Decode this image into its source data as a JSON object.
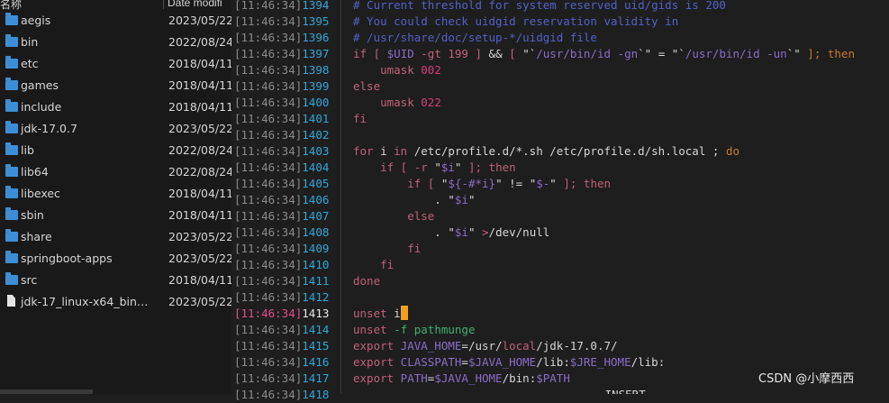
{
  "file_panel": {
    "column_name_label": "名称",
    "column_date_label": "Date modifi",
    "items": [
      {
        "name": "aegis",
        "date": "2023/05/22",
        "icon": "folder-icon"
      },
      {
        "name": "bin",
        "date": "2022/08/24",
        "icon": "folder-icon"
      },
      {
        "name": "etc",
        "date": "2018/04/11",
        "icon": "folder-icon"
      },
      {
        "name": "games",
        "date": "2018/04/11",
        "icon": "folder-icon"
      },
      {
        "name": "include",
        "date": "2018/04/11",
        "icon": "folder-icon"
      },
      {
        "name": "jdk-17.0.7",
        "date": "2023/05/22",
        "icon": "folder-icon"
      },
      {
        "name": "lib",
        "date": "2022/08/24",
        "icon": "folder-icon"
      },
      {
        "name": "lib64",
        "date": "2022/08/24",
        "icon": "folder-icon"
      },
      {
        "name": "libexec",
        "date": "2018/04/11",
        "icon": "folder-icon"
      },
      {
        "name": "sbin",
        "date": "2018/04/11",
        "icon": "folder-icon"
      },
      {
        "name": "share",
        "date": "2023/05/22",
        "icon": "folder-icon"
      },
      {
        "name": "springboot-apps",
        "date": "2023/05/22",
        "icon": "folder-icon"
      },
      {
        "name": "src",
        "date": "2018/04/11",
        "icon": "folder-icon"
      },
      {
        "name": "jdk-17_linux-x64_bin…",
        "date": "2023/05/22",
        "icon": "file-icon"
      }
    ]
  },
  "terminal": {
    "timestamp": "[11:46:34]",
    "current_line": 1413,
    "lines": [
      {
        "no": "1394",
        "segments": [
          {
            "t": "# Current threshold for system reserved uid/gids is 200",
            "c": "cm"
          }
        ]
      },
      {
        "no": "1395",
        "segments": [
          {
            "t": "# You could check uidgid reservation validity in",
            "c": "cm"
          }
        ]
      },
      {
        "no": "1396",
        "segments": [
          {
            "t": "# /usr/share/doc/setup-*/uidgid file",
            "c": "cm"
          }
        ]
      },
      {
        "no": "1397",
        "segments": [
          {
            "t": "if [ ",
            "c": "kw"
          },
          {
            "t": "$UID",
            "c": "var"
          },
          {
            "t": " -gt 199 ] ",
            "c": "kw"
          },
          {
            "t": "&& ",
            "c": "str"
          },
          {
            "t": "[ ",
            "c": "kw"
          },
          {
            "t": "\"`",
            "c": "str"
          },
          {
            "t": "/usr/bin/id -gn",
            "c": "var"
          },
          {
            "t": "`\" = \"`",
            "c": "str"
          },
          {
            "t": "/usr/bin/id -un",
            "c": "var"
          },
          {
            "t": "`\" ",
            "c": "str"
          },
          {
            "t": "]; then",
            "c": "kw2"
          }
        ]
      },
      {
        "no": "1398",
        "segments": [
          {
            "t": "    umask ",
            "c": "kw"
          },
          {
            "t": "002",
            "c": "num"
          }
        ]
      },
      {
        "no": "1399",
        "segments": [
          {
            "t": "else",
            "c": "kw"
          }
        ]
      },
      {
        "no": "1400",
        "segments": [
          {
            "t": "    umask ",
            "c": "kw"
          },
          {
            "t": "022",
            "c": "num"
          }
        ]
      },
      {
        "no": "1401",
        "segments": [
          {
            "t": "fi",
            "c": "kw"
          }
        ]
      },
      {
        "no": "1402",
        "segments": []
      },
      {
        "no": "1403",
        "segments": [
          {
            "t": "for",
            "c": "kw"
          },
          {
            "t": " i ",
            "c": "str"
          },
          {
            "t": "in",
            "c": "kw"
          },
          {
            "t": " /etc/profile.d/*.sh /etc/profile.d/sh.local ; ",
            "c": "str"
          },
          {
            "t": "do",
            "c": "kw2"
          }
        ]
      },
      {
        "no": "1404",
        "segments": [
          {
            "t": "    if [ -r ",
            "c": "kw"
          },
          {
            "t": "\"",
            "c": "str"
          },
          {
            "t": "$i",
            "c": "var"
          },
          {
            "t": "\" ",
            "c": "str"
          },
          {
            "t": "]; then",
            "c": "kw"
          }
        ]
      },
      {
        "no": "1405",
        "segments": [
          {
            "t": "        if [ ",
            "c": "kw"
          },
          {
            "t": "\"",
            "c": "str"
          },
          {
            "t": "${-#*i}",
            "c": "var"
          },
          {
            "t": "\" != \"",
            "c": "str"
          },
          {
            "t": "$-",
            "c": "var"
          },
          {
            "t": "\" ",
            "c": "str"
          },
          {
            "t": "]; then",
            "c": "kw"
          }
        ]
      },
      {
        "no": "1406",
        "segments": [
          {
            "t": "            . ",
            "c": "str"
          },
          {
            "t": "\"",
            "c": "str"
          },
          {
            "t": "$i",
            "c": "var"
          },
          {
            "t": "\"",
            "c": "str"
          }
        ]
      },
      {
        "no": "1407",
        "segments": [
          {
            "t": "        else",
            "c": "kw"
          }
        ]
      },
      {
        "no": "1408",
        "segments": [
          {
            "t": "            . ",
            "c": "str"
          },
          {
            "t": "\"",
            "c": "str"
          },
          {
            "t": "$i",
            "c": "var"
          },
          {
            "t": "\" ",
            "c": "str"
          },
          {
            "t": ">",
            "c": "kw"
          },
          {
            "t": "/dev/null",
            "c": "str"
          }
        ]
      },
      {
        "no": "1409",
        "segments": [
          {
            "t": "        fi",
            "c": "kw"
          }
        ]
      },
      {
        "no": "1410",
        "segments": [
          {
            "t": "    fi",
            "c": "kw"
          }
        ]
      },
      {
        "no": "1411",
        "segments": [
          {
            "t": "done",
            "c": "kw"
          }
        ]
      },
      {
        "no": "1412",
        "segments": []
      },
      {
        "no": "1413",
        "segments": [
          {
            "t": "unset",
            "c": "kw"
          },
          {
            "t": " i",
            "c": "str"
          }
        ]
      },
      {
        "no": "1414",
        "segments": [
          {
            "t": "unset",
            "c": "kw"
          },
          {
            "t": " -f pathmunge",
            "c": "grn"
          }
        ]
      },
      {
        "no": "1415",
        "segments": [
          {
            "t": "export",
            "c": "kw"
          },
          {
            "t": " JAVA_HOME",
            "c": "var"
          },
          {
            "t": "=/usr/",
            "c": "str"
          },
          {
            "t": "local",
            "c": "kw"
          },
          {
            "t": "/jdk-17.0.7/",
            "c": "str"
          }
        ]
      },
      {
        "no": "1416",
        "segments": [
          {
            "t": "export",
            "c": "kw"
          },
          {
            "t": " CLASSPATH",
            "c": "var"
          },
          {
            "t": "=",
            "c": "str"
          },
          {
            "t": "$JAVA_HOME",
            "c": "var"
          },
          {
            "t": "/lib:",
            "c": "str"
          },
          {
            "t": "$JRE_HOME",
            "c": "var"
          },
          {
            "t": "/lib:",
            "c": "str"
          }
        ]
      },
      {
        "no": "1417",
        "segments": [
          {
            "t": "export",
            "c": "kw"
          },
          {
            "t": " PATH",
            "c": "var"
          },
          {
            "t": "=",
            "c": "str"
          },
          {
            "t": "$JAVA_HOME",
            "c": "var"
          },
          {
            "t": "/bin:",
            "c": "str"
          },
          {
            "t": "$PATH",
            "c": "var"
          }
        ]
      },
      {
        "no": "1418",
        "segments": []
      }
    ],
    "mode_text": "-- INSERT --"
  },
  "watermark": "CSDN @小摩西西"
}
